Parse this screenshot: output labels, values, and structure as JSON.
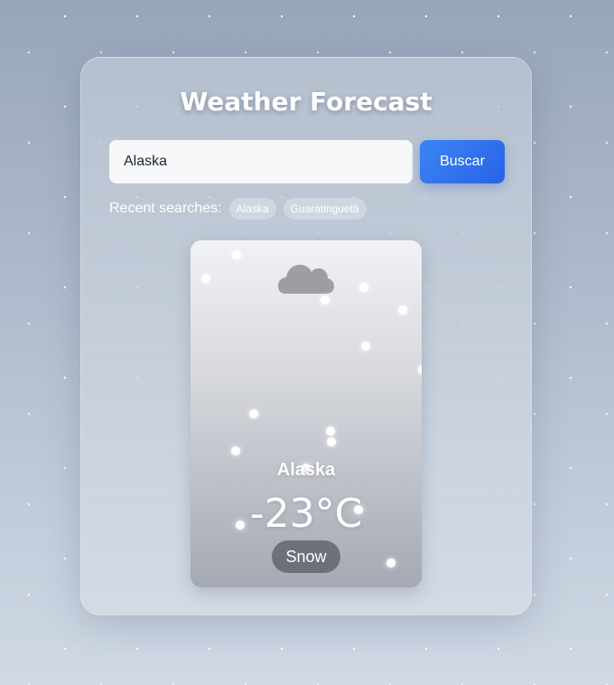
{
  "app": {
    "title": "Weather Forecast"
  },
  "search": {
    "value": "Alaska",
    "placeholder": "",
    "button_label": "Buscar"
  },
  "recent_searches": {
    "label": "Recent searches:",
    "items": [
      "Alaska",
      "Guaratinguetá"
    ]
  },
  "weather": {
    "icon": "cloud-icon",
    "city": "Alaska",
    "temperature": "-23°C",
    "condition": "Snow"
  },
  "colors": {
    "accent": "#2f6fee",
    "cloud": "#9c9ca0"
  }
}
